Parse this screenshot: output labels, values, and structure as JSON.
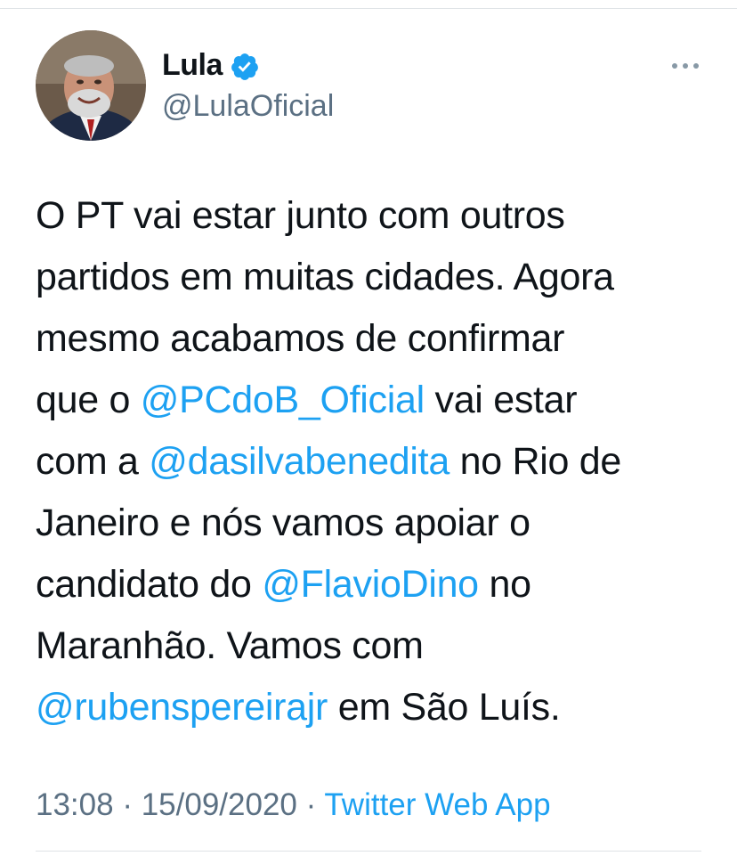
{
  "author": {
    "name": "Lula",
    "handle": "@LulaOficial",
    "verified_icon": "verified-badge-icon",
    "avatar": "profile-photo"
  },
  "menu": {
    "icon": "more-options-icon"
  },
  "tweet": {
    "lines": [
      {
        "text": "O PT vai estar junto com outros"
      },
      {
        "text": "partidos em muitas cidades. Agora"
      },
      {
        "text": "mesmo acabamos de confirmar"
      },
      {
        "before": "que o ",
        "mention": "@PCdoB_Oficial",
        "after": " vai estar"
      },
      {
        "before": "com a ",
        "mention": "@dasilvabenedita",
        "after": " no Rio de"
      },
      {
        "text": "Janeiro e nós vamos apoiar o"
      },
      {
        "before": "candidato do ",
        "mention": "@FlavioDino",
        "after": " no"
      },
      {
        "text": "Maranhão. Vamos com"
      },
      {
        "before": "",
        "mention": "@rubenspereirajr",
        "after": " em São Luís."
      }
    ]
  },
  "meta": {
    "time": "13:08",
    "separator1": " · ",
    "date": "15/09/2020",
    "separator2": " · ",
    "source": "Twitter Web App"
  },
  "colors": {
    "accent": "#1da1f2",
    "secondary_text": "#5b7083",
    "primary_text": "#0f1419"
  }
}
